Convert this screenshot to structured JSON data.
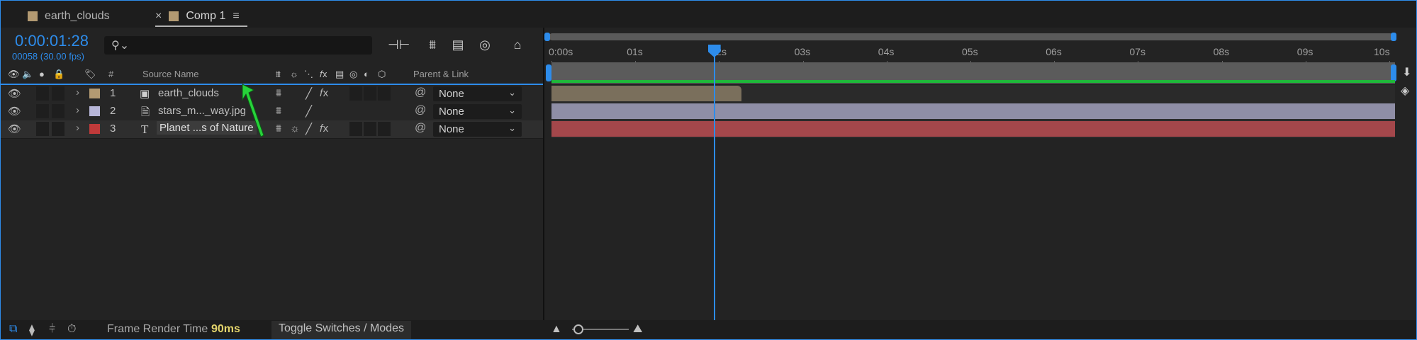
{
  "tabs": [
    {
      "name": "earth_clouds",
      "color": "#b39a72",
      "active": false
    },
    {
      "name": "Comp 1",
      "color": "#b39a72",
      "active": true
    }
  ],
  "tab_close_glyph": "×",
  "tab_menu_glyph": "≡",
  "timecode": "0:00:01:28",
  "frame_info": "00058 (30.00 fps)",
  "search": {
    "icon": "search-icon",
    "value": ""
  },
  "column_headers": {
    "hash": "#",
    "source_name": "Source Name",
    "parent_link": "Parent & Link"
  },
  "layers": [
    {
      "num": "1",
      "name": "earth_clouds",
      "label_color": "#b39a72",
      "type_icon": "composition-icon",
      "parent": "None",
      "selected": false
    },
    {
      "num": "2",
      "name": "stars_m..._way.jpg",
      "label_color": "#b7b6d8",
      "type_icon": "footage-icon",
      "parent": "None",
      "selected": false
    },
    {
      "num": "3",
      "name": "Planet ...s of Nature",
      "label_color": "#c03a3a",
      "type_icon": "text-layer-icon",
      "parent": "None",
      "selected": true
    }
  ],
  "ruler": {
    "labels": [
      "0:00s",
      "01s",
      "02s",
      "03s",
      "04s",
      "05s",
      "06s",
      "07s",
      "08s",
      "09s",
      "10s"
    ]
  },
  "tracks": [
    {
      "bar_color": "#7a6f5c",
      "end_fraction": 0.225
    },
    {
      "bar_color": "#8f8ea6",
      "end_fraction": 1.0
    },
    {
      "bar_color": "#a4474b",
      "end_fraction": 1.0
    }
  ],
  "playhead_time_s": 1.93,
  "status": {
    "frame_render_label": "Frame Render Time",
    "frame_render_value": "90ms",
    "toggle_label": "Toggle Switches / Modes"
  },
  "colors": {
    "accent": "#2d8ceb",
    "green_range": "#1fb83a"
  }
}
